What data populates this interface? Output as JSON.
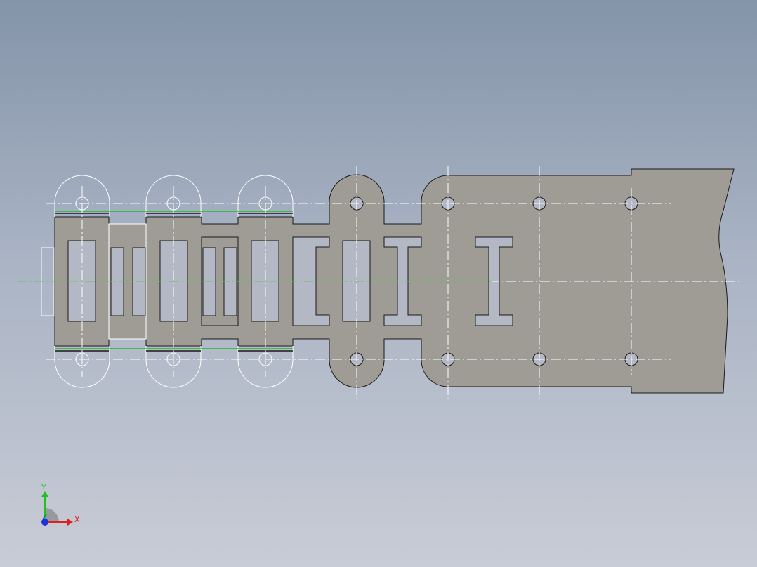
{
  "viewport": {
    "background_top": "#8494a9",
    "background_bottom": "#c8ccd6"
  },
  "part": {
    "fill": "#9e9c94",
    "edge": "#1a1a1a",
    "construction_line_color": "#ffffff",
    "highlight_line_color": "#22bb22"
  },
  "triad": {
    "x_label": "X",
    "y_label": "Y",
    "z_label": "Z",
    "x_color": "#e02020",
    "y_color": "#20c020",
    "z_color": "#2030e0"
  }
}
